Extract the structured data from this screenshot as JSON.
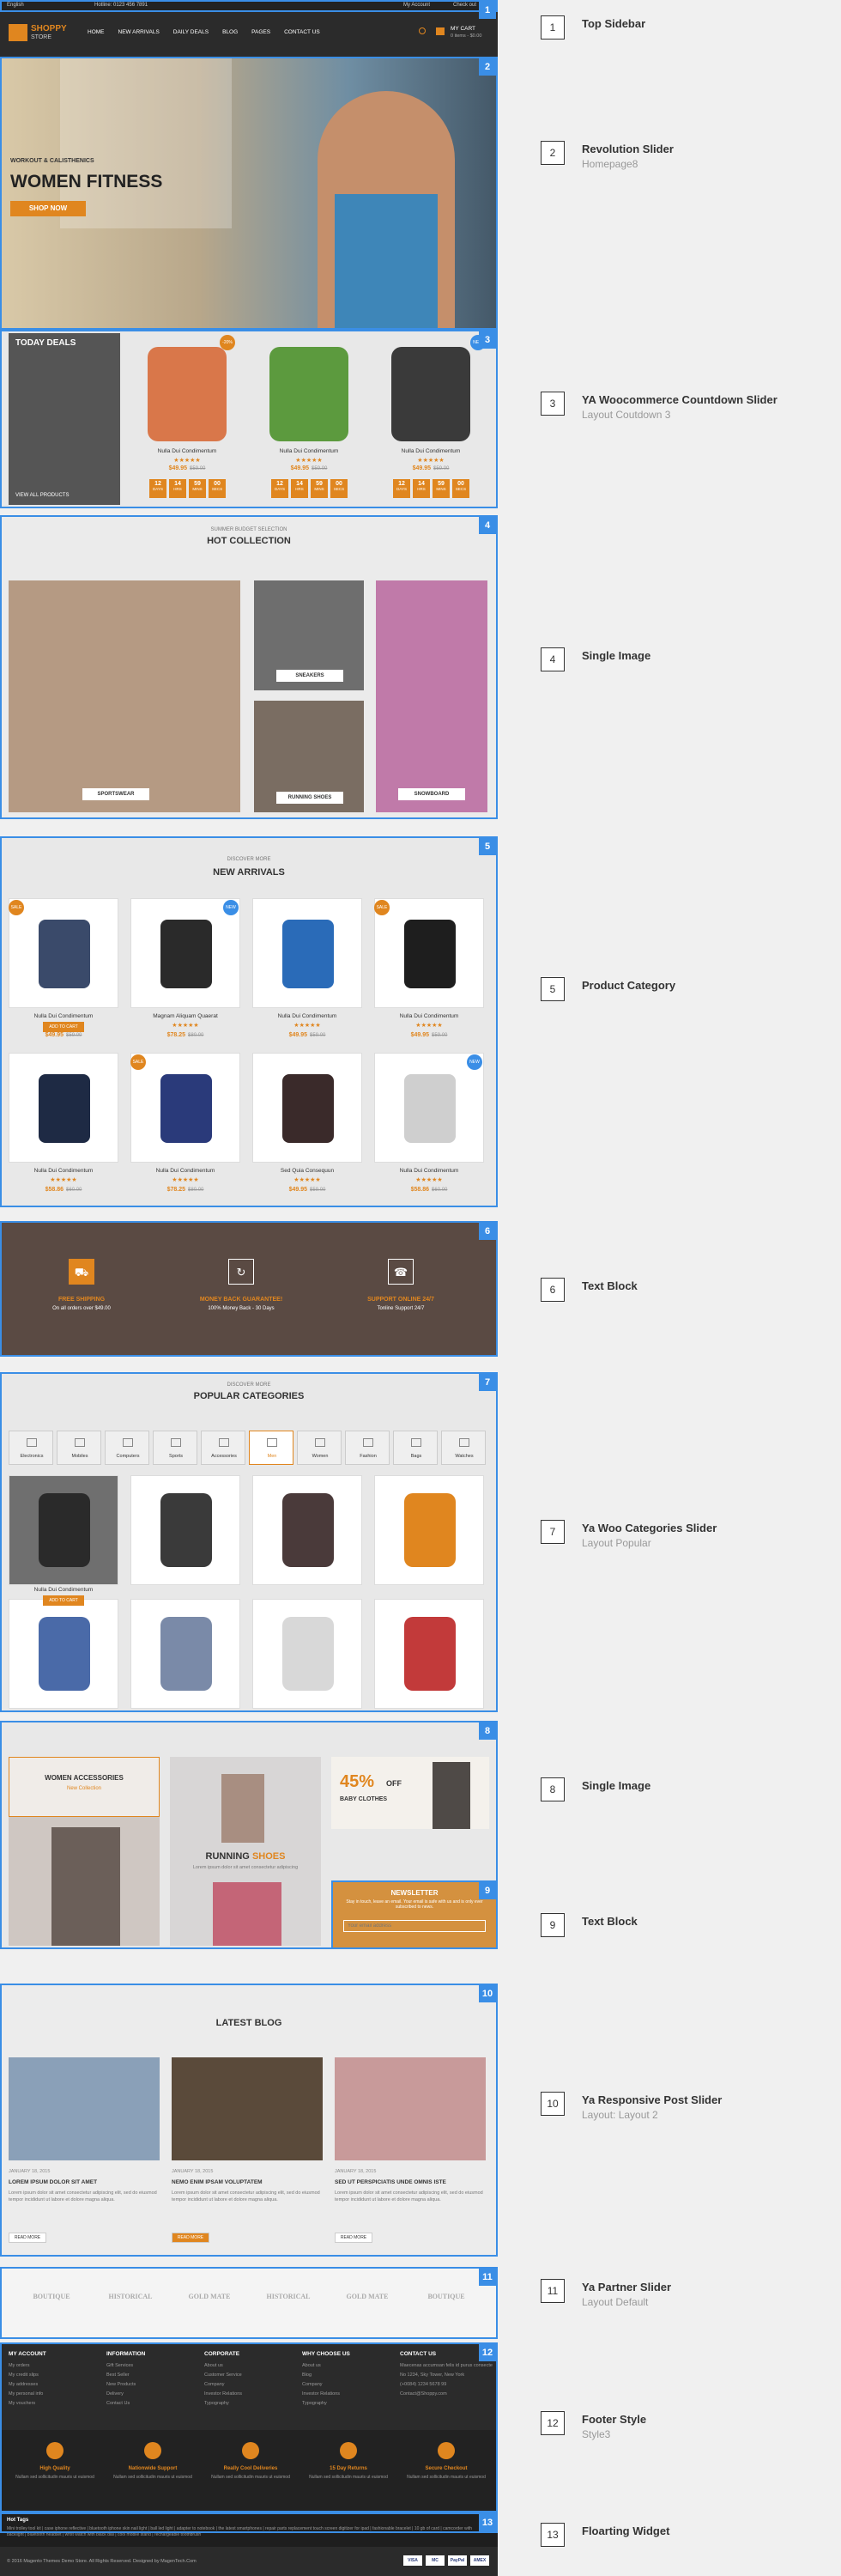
{
  "topbar": {
    "lang": "English",
    "hotline": "Hotline: 0123 456 7891",
    "account": "My Account",
    "checkout": "Check out"
  },
  "header": {
    "logo_line1": "SHOPPY",
    "logo_line2": "STORE",
    "menu": [
      "HOME",
      "NEW ARRIVALS",
      "DAILY DEALS",
      "BLOG",
      "PAGES",
      "CONTACT US"
    ],
    "cart_label": "MY CART",
    "cart_sub": "0 items - $0.00"
  },
  "hero": {
    "kicker": "WORKOUT & CALISTHENICS",
    "title": "WOMEN FITNESS",
    "button": "SHOP NOW"
  },
  "deals": {
    "title": "TODAY DEALS",
    "view_all": "VIEW ALL PRODUCTS",
    "products": [
      {
        "name": "Nulla Dui Condimentum",
        "price": "$49.95",
        "old": "$59.00",
        "badge": "-20%",
        "timer": [
          "12",
          "14",
          "59",
          "00"
        ]
      },
      {
        "name": "Nulla Dui Condimentum",
        "price": "$49.95",
        "old": "$59.00",
        "badge": "",
        "timer": [
          "12",
          "14",
          "59",
          "00"
        ]
      },
      {
        "name": "Nulla Dui Condimentum",
        "price": "$49.95",
        "old": "$59.00",
        "badge": "NEW",
        "timer": [
          "12",
          "14",
          "59",
          "00"
        ]
      }
    ],
    "timer_units": [
      "DAYS",
      "HRS",
      "MINS",
      "SECS"
    ]
  },
  "hot": {
    "kicker": "SUMMER BUDGET SELECTION",
    "title": "HOT COLLECTION",
    "items": [
      "SPORTSWEAR",
      "SNEAKERS",
      "RUNNING SHOES",
      "SNOWBOARD"
    ]
  },
  "newarr": {
    "kicker": "DISCOVER MORE",
    "title": "NEW ARRIVALS",
    "add_to_cart": "ADD TO CART",
    "products": [
      {
        "name": "Nulla Dui Condimentum",
        "price": "$49.95",
        "old": "$59.00",
        "badge": "SALE"
      },
      {
        "name": "Magnam Aliquam Quaerat",
        "price": "$78.25",
        "old": "$80.00",
        "badge": "NEW"
      },
      {
        "name": "Nulla Dui Condimentum",
        "price": "$49.95",
        "old": "$59.00",
        "badge": ""
      },
      {
        "name": "Nulla Dui Condimentum",
        "price": "$49.95",
        "old": "$59.00",
        "badge": "SALE"
      },
      {
        "name": "Nulla Dui Condimentum",
        "price": "$58.86",
        "old": "$60.00",
        "badge": ""
      },
      {
        "name": "Nulla Dui Condimentum",
        "price": "$78.25",
        "old": "$80.00",
        "badge": "SALE"
      },
      {
        "name": "Sed Quia Consequun",
        "price": "$49.95",
        "old": "$59.00",
        "badge": ""
      },
      {
        "name": "Nulla Dui Condimentum",
        "price": "$58.86",
        "old": "$60.00",
        "badge": "NEW"
      }
    ]
  },
  "services": [
    {
      "title": "FREE SHIPPING",
      "sub": "On all orders over $49.00",
      "icon": "truck-icon"
    },
    {
      "title": "MONEY BACK GUARANTEE!",
      "sub": "100% Money Back - 30 Days",
      "icon": "refresh-icon"
    },
    {
      "title": "SUPPORT ONLINE 24/7",
      "sub": "Tonline Support 24/7",
      "icon": "phone-icon"
    }
  ],
  "popular": {
    "kicker": "DISCOVER MORE",
    "title": "POPULAR CATEGORIES",
    "tabs": [
      "Electronics",
      "Mobiles",
      "Computers",
      "Sports",
      "Accessories",
      "Men",
      "Women",
      "Fashion",
      "Bags",
      "Watches"
    ],
    "product_name": "Nulla Dui Condimentum",
    "add_to_cart": "ADD TO CART"
  },
  "banners": {
    "accessories_title": "WOMEN ACCESSORIES",
    "accessories_sub": "New Collection",
    "running_a": "RUNNING",
    "running_b": "SHOES",
    "running_sub": "Lorem ipsum dolor sit amet consectetur adipiscing",
    "off_pct": "45%",
    "off_word": "OFF",
    "baby": "BABY CLOTHES"
  },
  "newsletter": {
    "title": "NEWSLETTER",
    "text": "Stay in touch, leave an email. Your email is safe with us and is only ever subscribed to news.",
    "placeholder": "Your email address"
  },
  "blog": {
    "title": "LATEST BLOG",
    "posts": [
      {
        "date": "JANUARY 18, 2015",
        "title": "LOREM IPSUM DOLOR SIT AMET",
        "excerpt": "Lorem ipsum dolor sit amet consectetur adipiscing elit, sed do eiusmod tempor incididunt ut labore et dolore magna aliqua.",
        "btn": "READ MORE"
      },
      {
        "date": "JANUARY 18, 2015",
        "title": "NEMO ENIM IPSAM VOLUPTATEM",
        "excerpt": "Lorem ipsum dolor sit amet consectetur adipiscing elit, sed do eiusmod tempor incididunt ut labore et dolore magna aliqua.",
        "btn": "READ MORE"
      },
      {
        "date": "JANUARY 18, 2015",
        "title": "SED UT PERSPICIATIS UNDE OMNIS ISTE",
        "excerpt": "Lorem ipsum dolor sit amet consectetur adipiscing elit, sed do eiusmod tempor incididunt ut labore et dolore magna aliqua.",
        "btn": "READ MORE"
      }
    ]
  },
  "partners": [
    "BOUTIQUE",
    "HISTORICAL",
    "GOLD MATE",
    "HISTORICAL",
    "GOLD MATE",
    "BOUTIQUE"
  ],
  "footer": {
    "cols": [
      {
        "title": "MY ACCOUNT",
        "items": [
          "My orders",
          "My credit slips",
          "My addresses",
          "My personal info",
          "My vouchers"
        ]
      },
      {
        "title": "INFORMATION",
        "items": [
          "Gift Services",
          "Best Seller",
          "New Products",
          "Delivery",
          "Contact Us"
        ]
      },
      {
        "title": "CORPORATE",
        "items": [
          "About us",
          "Customer Service",
          "Company",
          "Investor Relations",
          "Typography"
        ]
      },
      {
        "title": "WHY CHOOSE US",
        "items": [
          "About us",
          "Blog",
          "Company",
          "Investor Relations",
          "Typography"
        ]
      },
      {
        "title": "CONTACT US",
        "items": [
          "Maecenas accumsan felis id purus consectetur",
          "No 1234, Sky Tower, New York",
          "(+0084) 1234 5678 99",
          "Contact@Shoppy.com"
        ]
      }
    ],
    "features": [
      {
        "title": "High Quality",
        "sub": "Nullam sed sollicitudin mauris ut euismod",
        "icon": "medal-icon"
      },
      {
        "title": "Nationwide Support",
        "sub": "Nullam sed sollicitudin mauris ut euismod",
        "icon": "support-icon"
      },
      {
        "title": "Really Cool Deliveries",
        "sub": "Nullam sed sollicitudin mauris ut euismod",
        "icon": "truck-icon"
      },
      {
        "title": "15 Day Returns",
        "sub": "Nullam sed sollicitudin mauris ut euismod",
        "icon": "plane-icon"
      },
      {
        "title": "Secure Checkout",
        "sub": "Nullam sed sollicitudin mauris ut euismod",
        "icon": "lock-icon"
      }
    ],
    "tags_title": "Hot Tags",
    "tags_text": "Mini trolley tool kit | case iphone reflective | bluetooth iphone skin nail light | ball led light | adapter to notebook | the latest smartphones | repair parts replacement touch screen digitizer for ipad | fashionable bracelet | 10 gb of card | camcorder with backlight | bluetooth headset | wrist watch with black dial | cool mobile stand | rechargeable toothbrush",
    "copyright": "© 2016 Magento Themes Demo Store. All Rights Reserved. Designed by MagenTech.Com",
    "payments": [
      "VISA",
      "MC",
      "PayPal",
      "AMEX"
    ]
  },
  "labels": [
    {
      "n": "1",
      "t": "Top Sidebar",
      "s": ""
    },
    {
      "n": "2",
      "t": "Revolution Slider",
      "s": "Homepage8"
    },
    {
      "n": "3",
      "t": "YA Woocommerce Countdown Slider",
      "s": "Layout Coutdown 3"
    },
    {
      "n": "4",
      "t": "Single Image",
      "s": ""
    },
    {
      "n": "5",
      "t": "Product Category",
      "s": ""
    },
    {
      "n": "6",
      "t": "Text Block",
      "s": ""
    },
    {
      "n": "7",
      "t": "Ya Woo Categories Slider",
      "s": "Layout Popular"
    },
    {
      "n": "8",
      "t": "Single Image",
      "s": ""
    },
    {
      "n": "9",
      "t": "Text Block",
      "s": ""
    },
    {
      "n": "10",
      "t": "Ya Responsive Post Slider",
      "s": "Layout: Layout 2"
    },
    {
      "n": "11",
      "t": "Ya Partner Slider",
      "s": "Layout Default"
    },
    {
      "n": "12",
      "t": "Footer Style",
      "s": "Style3"
    },
    {
      "n": "13",
      "t": "Floarting  Widget",
      "s": ""
    }
  ],
  "colors": {
    "accent": "#e0861f",
    "blue": "#3a8ee6",
    "dark": "#2b2b2b"
  }
}
